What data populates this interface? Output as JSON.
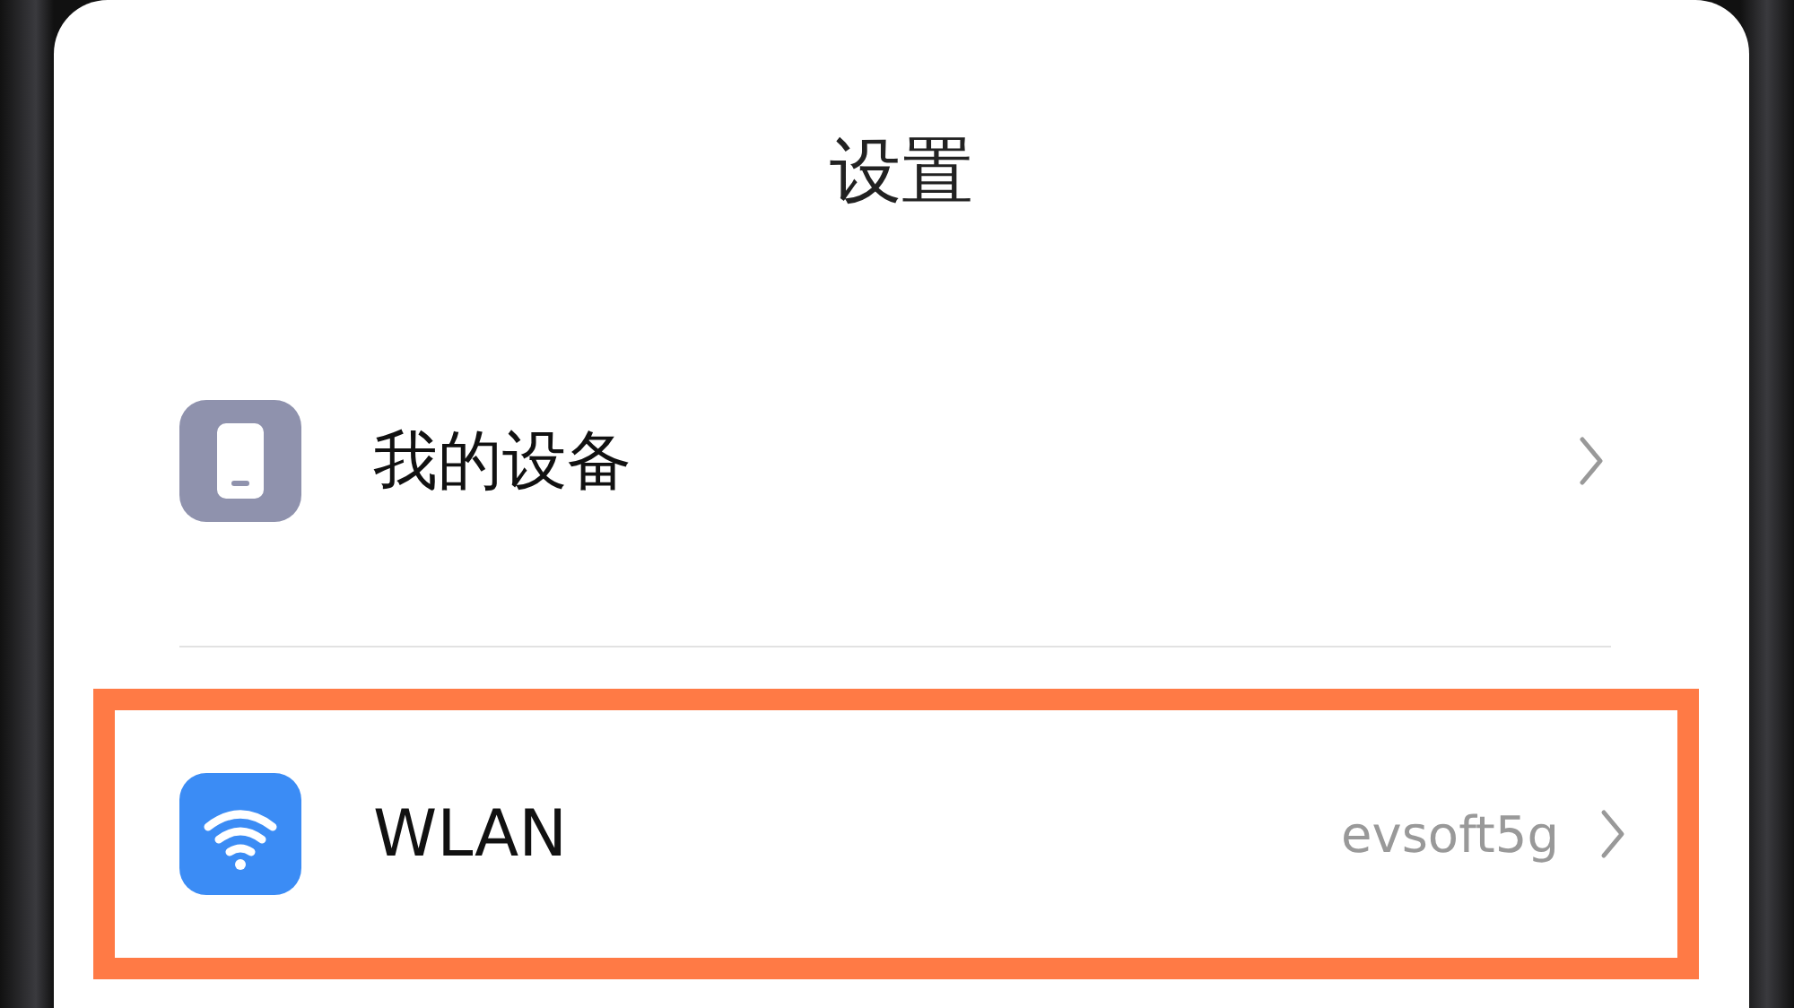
{
  "page": {
    "title": "设置"
  },
  "items": [
    {
      "kind": "device",
      "label": "我的设备",
      "highlighted": false
    },
    {
      "kind": "wifi",
      "label": "WLAN",
      "value": "evsoft5g",
      "highlighted": true
    }
  ]
}
